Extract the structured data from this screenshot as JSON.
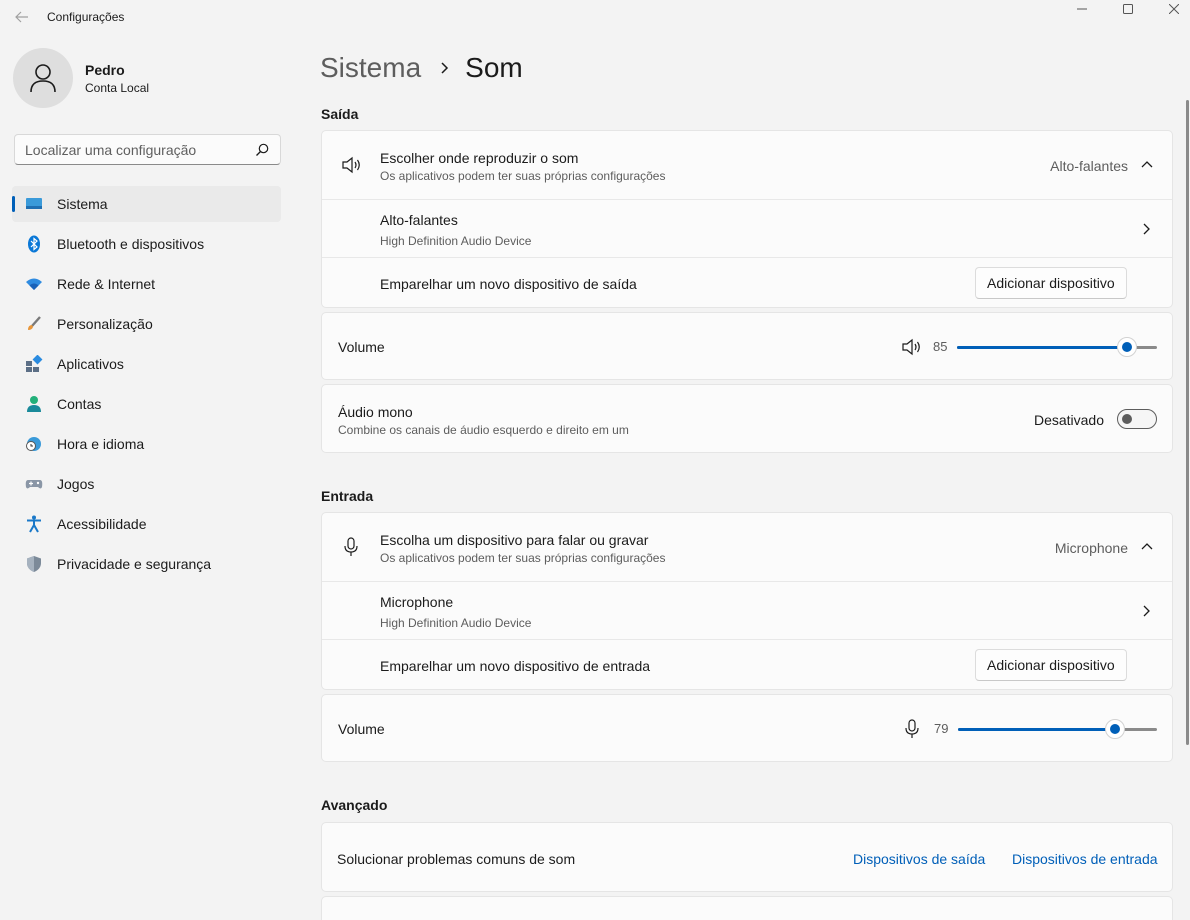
{
  "window": {
    "title": "Configurações"
  },
  "profile": {
    "name": "Pedro",
    "account_type": "Conta Local"
  },
  "search": {
    "placeholder": "Localizar uma configuração"
  },
  "nav": {
    "items": [
      {
        "label": "Sistema",
        "icon": "system-icon",
        "active": true
      },
      {
        "label": "Bluetooth e dispositivos",
        "icon": "bluetooth-icon"
      },
      {
        "label": "Rede & Internet",
        "icon": "wifi-icon"
      },
      {
        "label": "Personalização",
        "icon": "brush-icon"
      },
      {
        "label": "Aplicativos",
        "icon": "apps-icon"
      },
      {
        "label": "Contas",
        "icon": "person-icon"
      },
      {
        "label": "Hora e idioma",
        "icon": "globe-clock-icon"
      },
      {
        "label": "Jogos",
        "icon": "gamepad-icon"
      },
      {
        "label": "Acessibilidade",
        "icon": "accessibility-icon"
      },
      {
        "label": "Privacidade e segurança",
        "icon": "shield-icon"
      }
    ]
  },
  "breadcrumb": {
    "parent": "Sistema",
    "current": "Som"
  },
  "output": {
    "section_title": "Saída",
    "choose_title": "Escolher onde reproduzir o som",
    "choose_subtitle": "Os aplicativos podem ter suas próprias configurações",
    "choose_value": "Alto-falantes",
    "device_name": "Alto-falantes",
    "device_sub": "High Definition Audio Device",
    "pair_label": "Emparelhar um novo dispositivo de saída",
    "add_button": "Adicionar dispositivo",
    "volume_label": "Volume",
    "volume_value": "85",
    "volume_percent": 85,
    "mono_title": "Áudio mono",
    "mono_subtitle": "Combine os canais de áudio esquerdo e direito em um",
    "mono_state": "Desativado",
    "mono_on": false
  },
  "input": {
    "section_title": "Entrada",
    "choose_title": "Escolha um dispositivo para falar ou gravar",
    "choose_subtitle": "Os aplicativos podem ter suas próprias configurações",
    "choose_value": "Microphone",
    "device_name": "Microphone",
    "device_sub": "High Definition Audio Device",
    "pair_label": "Emparelhar um novo dispositivo de entrada",
    "add_button": "Adicionar dispositivo",
    "volume_label": "Volume",
    "volume_value": "79",
    "volume_percent": 79
  },
  "advanced": {
    "section_title": "Avançado",
    "troubleshoot_label": "Solucionar problemas comuns de som",
    "output_devices_link": "Dispositivos de saída",
    "input_devices_link": "Dispositivos de entrada"
  },
  "colors": {
    "accent": "#005fb8",
    "background": "#f3f3f3",
    "card": "#fbfbfb"
  }
}
